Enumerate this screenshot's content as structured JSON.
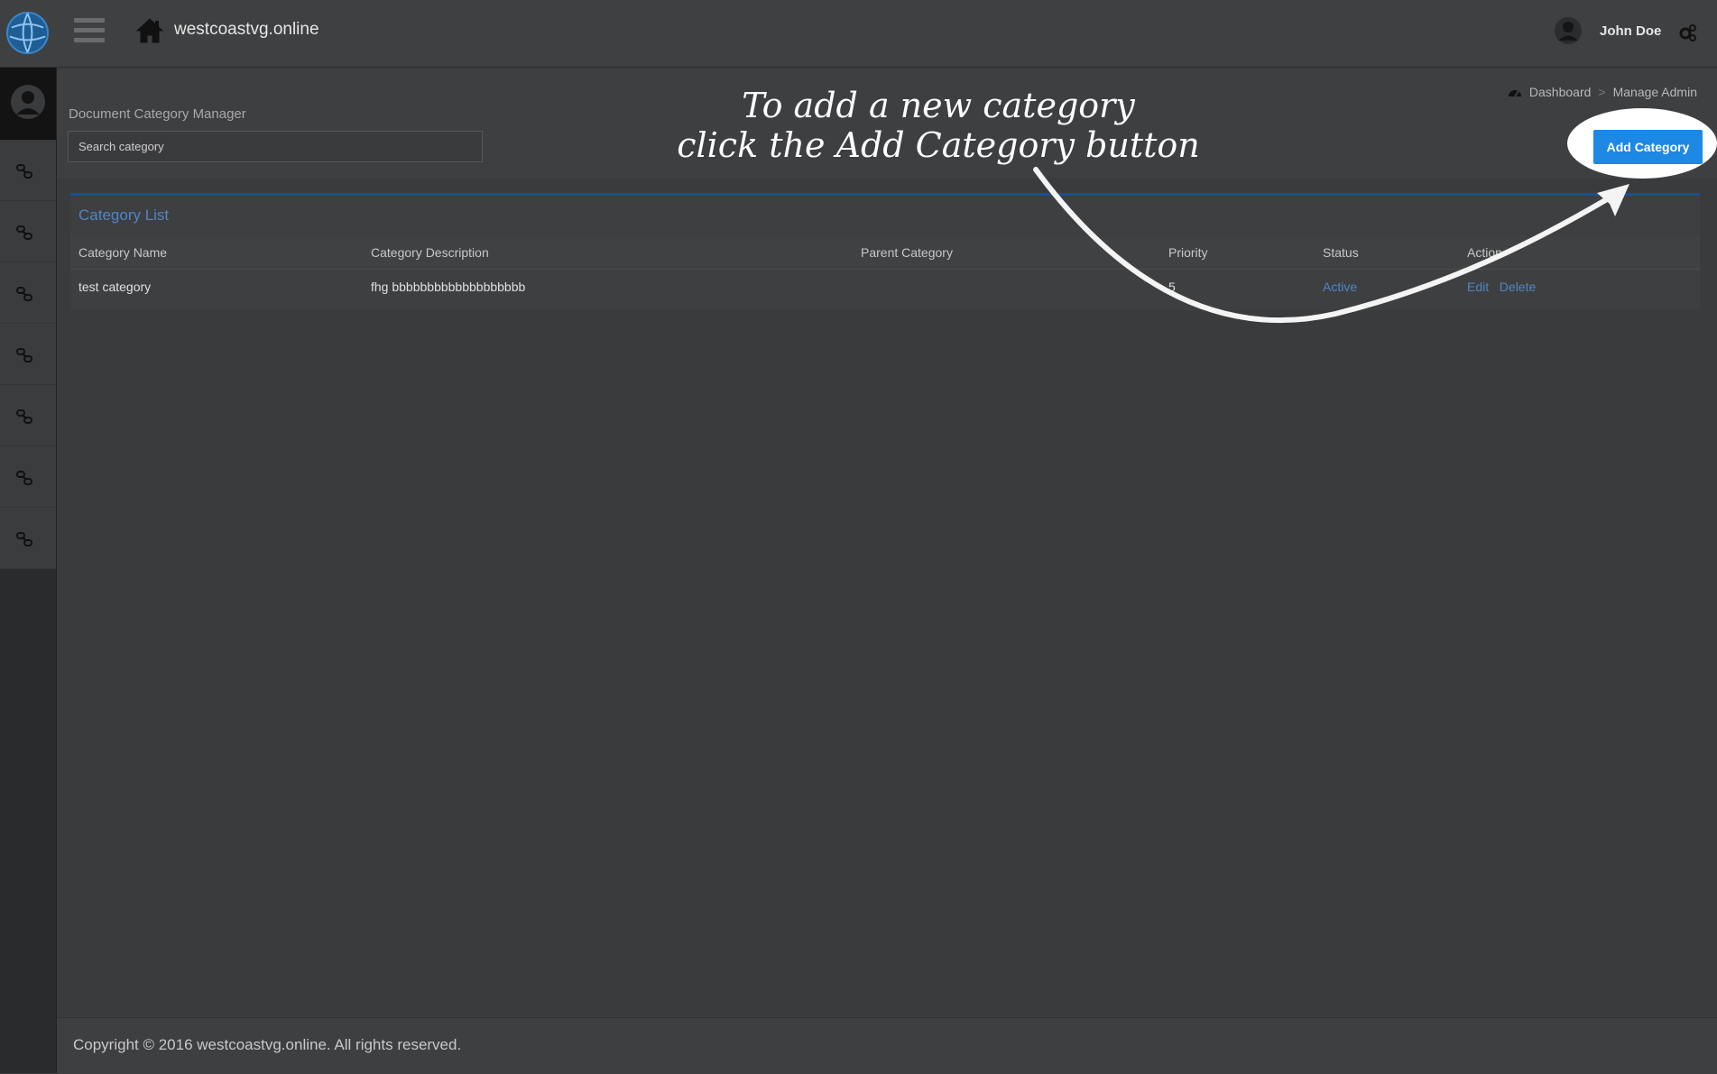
{
  "header": {
    "site_name": "westcoastvg.online",
    "user_name": "John Doe",
    "icons": [
      "globe-logo-icon",
      "hamburger-menu-icon",
      "home-icon",
      "user-avatar-icon",
      "settings-gears-icon"
    ]
  },
  "sidebar": {
    "items": [
      {
        "icon": "link-icon"
      },
      {
        "icon": "link-icon"
      },
      {
        "icon": "link-icon"
      },
      {
        "icon": "link-icon"
      },
      {
        "icon": "link-icon"
      },
      {
        "icon": "link-icon"
      },
      {
        "icon": "link-icon"
      }
    ]
  },
  "page": {
    "title": "Document Category Manager",
    "search_placeholder": "Search category",
    "add_button": "Add Category",
    "breadcrumb": [
      "Dashboard",
      "Manage Admin"
    ]
  },
  "panel": {
    "title": "Category List",
    "columns": [
      "Category Name",
      "Category Description",
      "Parent Category",
      "Priority",
      "Status",
      "Action"
    ],
    "rows": [
      {
        "name": "test category",
        "description": "fhg bbbbbbbbbbbbbbbbbbb",
        "parent": "",
        "priority": "5",
        "status": "Active",
        "edit": "Edit",
        "delete": "Delete"
      }
    ]
  },
  "annotation": {
    "line1": "To add a new category",
    "line2": "click the Add Category button"
  },
  "footer": {
    "copyright": "Copyright © 2016 westcoastvg.online. All rights reserved."
  },
  "colors": {
    "accent": "#1e88e5",
    "link": "#4f86c6",
    "background": "#3a3b3d"
  }
}
